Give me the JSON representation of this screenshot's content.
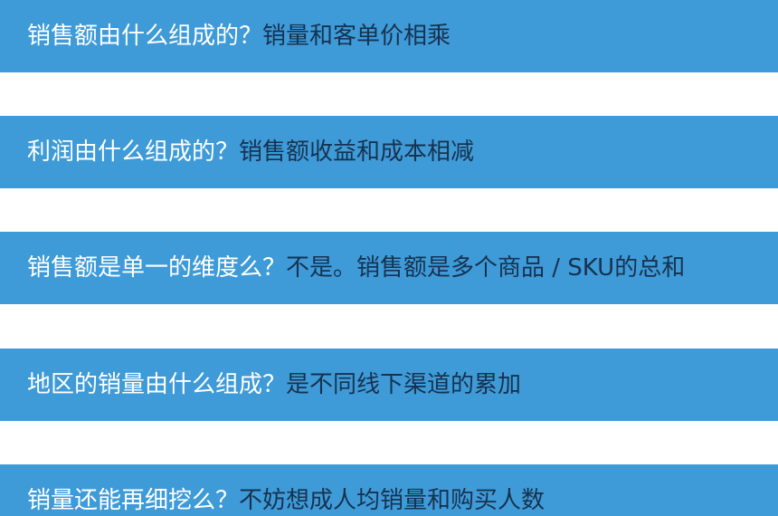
{
  "items": [
    {
      "question": "销售额由什么组成的？",
      "answer": "销量和客单价相乘"
    },
    {
      "question": "利润由什么组成的？",
      "answer": "销售额收益和成本相减"
    },
    {
      "question": "销售额是单一的维度么？",
      "answer": "不是。销售额是多个商品 / SKU的总和"
    },
    {
      "question": "地区的销量由什么组成？",
      "answer": "是不同线下渠道的累加"
    },
    {
      "question": "销量还能再细挖么？",
      "answer": "不妨想成人均销量和购买人数"
    }
  ],
  "colors": {
    "bar_background": "#3e9bd8",
    "question_text": "#ffffff",
    "answer_text": "#17324f"
  }
}
